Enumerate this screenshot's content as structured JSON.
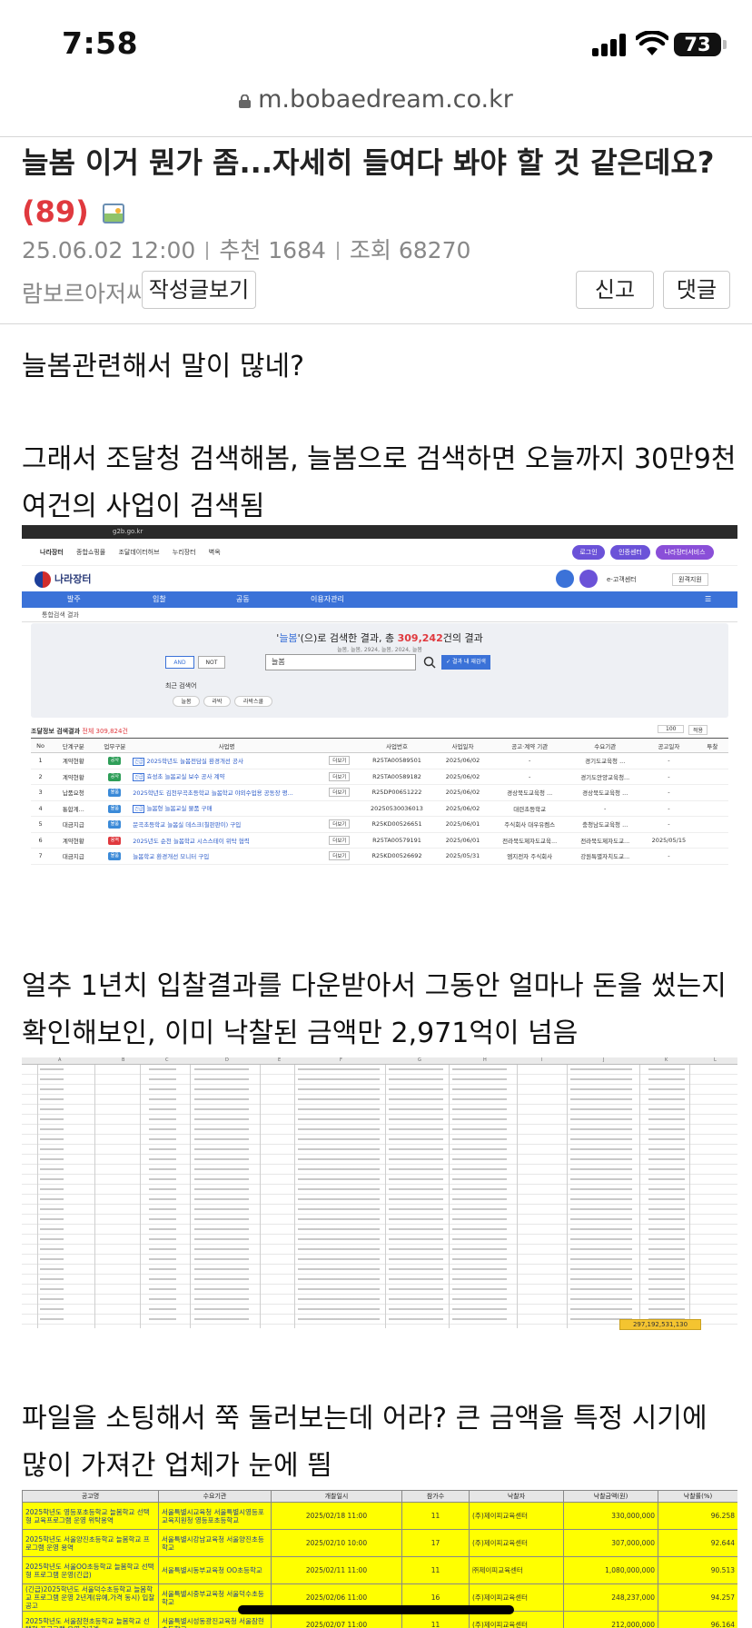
{
  "status_bar": {
    "time": "7:58",
    "battery": "73"
  },
  "url": "m.bobaedream.co.kr",
  "post": {
    "title": "늘봄 이거 뭔가 좀...자세히 들여다 봐야 할 것 같은데요?",
    "comment_count": "(89)",
    "date": "25.06.02  12:00",
    "recommend": "추천 1684",
    "views": "조회 68270",
    "author": "람보르아저씨",
    "my_posts_button": "작성글보기",
    "report_button": "신고",
    "comment_button": "댓글"
  },
  "body": {
    "p1": "늘봄관련해서 말이 많네?",
    "p2": "그래서 조달청 검색해봄, 늘봄으로 검색하면 오늘까지 30만9천여건의 사업이 검색됨",
    "p3": "얼추 1년치 입찰결과를 다운받아서 그동안 얼마나 돈을 썼는지 확인해보인, 이미 낙찰된 금액만 2,971억이 넘음",
    "p4": "파일을 소팅해서 쭉 둘러보는데 어라? 큰 금액을 특정 시기에 많이 가져간 업체가 눈에 띔"
  },
  "shot1": {
    "browser_url": "g2b.go.kr",
    "topnav": [
      "나라장터",
      "종합쇼핑몰",
      "조달데이터허브",
      "누리장터",
      "벽옥"
    ],
    "pills": [
      "로그인",
      "인증센터",
      "나라장터서비스"
    ],
    "logo": "나라장터",
    "help": "e-고객센터",
    "remote": "원격지원",
    "menu": [
      "발주",
      "입찰",
      "공동",
      "이용자관리"
    ],
    "crumb": "통합검색 결과",
    "keyword": "늘봄",
    "result_pre": "'",
    "result_mid": "'(으)로 검색한 결과, 총 ",
    "result_count": "309,242",
    "result_post": "건의 결과",
    "related": "늘봄, 늘봄, 2924, 늘봄, 2024, 늘봄",
    "and": "AND",
    "not": "NOT",
    "input_value": "늘봄",
    "search_in": "✓ 결과 내 재검색",
    "recent_label": "최근 검색어",
    "chips": [
      "늘봄",
      "라박",
      "라박스쿨"
    ],
    "list_title": "조달정보 검색결과",
    "list_total": "전체 309,824건",
    "per_page": "100",
    "sort": "적용",
    "headers": [
      "No",
      "단계구분",
      "업무구분",
      "사업명",
      "",
      "사업번호",
      "사업일자",
      "공고·계약 기관",
      "수요기관",
      "공고일자",
      "투찰"
    ],
    "rows": [
      {
        "no": "1",
        "stage": "계약현황",
        "tag": "공사",
        "tagc": "g",
        "ynh": "긴급",
        "name": "2025학년도 늘봄전담실 환경개선 공사",
        "detail": "더보기",
        "num": "R25TA00589501",
        "date": "2025/06/02",
        "org": "-",
        "demand": "경기도교육청 ...",
        "ann": "-"
      },
      {
        "no": "2",
        "stage": "계약현황",
        "tag": "공사",
        "tagc": "g",
        "ynh": "긴급",
        "name": "효성초 늘봄교실 보수 공사 계약",
        "detail": "더보기",
        "num": "R25TA00589182",
        "date": "2025/06/02",
        "org": "-",
        "demand": "경기도안양교육청...",
        "ann": "-"
      },
      {
        "no": "3",
        "stage": "납품요청",
        "tag": "물품",
        "tagc": "b",
        "ynh": "",
        "name": "2025학년도 김천부곡초등학교 늘봄학교 야외수업용 공동장 평...",
        "detail": "더보기",
        "num": "R25DP00651222",
        "date": "2025/06/02",
        "org": "경상북도교육청 ...",
        "demand": "경상북도교육청 ...",
        "ann": "-"
      },
      {
        "no": "4",
        "stage": "통합계...",
        "tag": "물품",
        "tagc": "b",
        "ynh": "긴급",
        "name": "늘봄형 늘봄교실 물품 구매",
        "detail": "",
        "num": "20250530036013",
        "date": "2025/06/02",
        "org": "대련초등학교",
        "demand": "-",
        "ann": "-"
      },
      {
        "no": "5",
        "stage": "대금지급",
        "tag": "물품",
        "tagc": "b",
        "ynh": "",
        "name": "문곡초등학교 늘봄실 데스크(칠판판이) 구입",
        "detail": "더보기",
        "num": "R25KD00526651",
        "date": "2025/06/01",
        "org": "주식회사 대우유켐스",
        "demand": "충청남도교육청 ...",
        "ann": "-"
      },
      {
        "no": "6",
        "stage": "계약현황",
        "tag": "용역",
        "tagc": "r",
        "ynh": "",
        "name": "2025년도 순천 늘봄학교 시스스테이 위탁 협력",
        "detail": "더보기",
        "num": "R25TA00579191",
        "date": "2025/06/01",
        "org": "전라북도제자도교육...",
        "demand": "전라북도제자도교...",
        "ann": "2025/05/15"
      },
      {
        "no": "7",
        "stage": "대금지급",
        "tag": "물품",
        "tagc": "b",
        "ynh": "",
        "name": "늘봄학교 환경개선 모니터 구입",
        "detail": "더보기",
        "num": "R25KD00526692",
        "date": "2025/05/31",
        "org": "엠지전자 주식회사",
        "demand": "강원특별자치도교...",
        "ann": "-"
      }
    ]
  },
  "shot2": {
    "columns": [
      "A",
      "B",
      "C",
      "D",
      "E",
      "F",
      "G",
      "H",
      "I",
      "J",
      "K",
      "L"
    ],
    "total": "297,192,531,130"
  },
  "shot3": {
    "headers": [
      "공고명",
      "수요기관",
      "개찰일시",
      "참가수",
      "낙찰자",
      "낙찰금액(원)",
      "낙찰률(%)"
    ],
    "rows": [
      {
        "name": "2025학년도 영등포초등학교 늘봄학교 선택형 교육프로그램 운영 위탁용역",
        "org": "서울특별시교육청 서울특별시영등포교육지원청 영등포초등학교",
        "date": "2025/02/18 11:00",
        "n": "11",
        "winner": "(주)제이피교육센터",
        "amount": "330,000,000",
        "rate": "96.258"
      },
      {
        "name": "2025학년도 서울양진초등학교 늘봄학교 프로그램 운영 용역",
        "org": "서울특별시강남교육청 서울양진초등학교",
        "date": "2025/02/10 10:00",
        "n": "17",
        "winner": "(주)제이피교육센터",
        "amount": "307,000,000",
        "rate": "92.644"
      },
      {
        "name": "2025학년도 서울OO초등학교 늘봄학교 선택형 프로그램 운영(긴급)",
        "org": "서울특별시동부교육청 OO초등학교",
        "date": "2025/02/11 11:00",
        "n": "11",
        "winner": "㈜제이피교육센터",
        "amount": "1,080,000,000",
        "rate": "90.513"
      },
      {
        "name": "(긴급)2025학년도 서울덕수초등학교 늘봄학교 프로그램 운영 2년계(유예,가격 동시) 입찰 공고",
        "org": "서울특별시중부교육청 서울덕수초등학교",
        "date": "2025/02/06 11:00",
        "n": "16",
        "winner": "(주)제이피교육센터",
        "amount": "248,237,000",
        "rate": "94.257"
      },
      {
        "name": "2025학년도 서울잠현초등학교 늘봄학교 선택형 프로그램 운영 2년계",
        "org": "서울특별시성동광진교육청 서울잠현초등학교",
        "date": "2025/02/07 11:00",
        "n": "11",
        "winner": "(주)제이피교육센터",
        "amount": "212,000,000",
        "rate": "96.164"
      }
    ]
  }
}
